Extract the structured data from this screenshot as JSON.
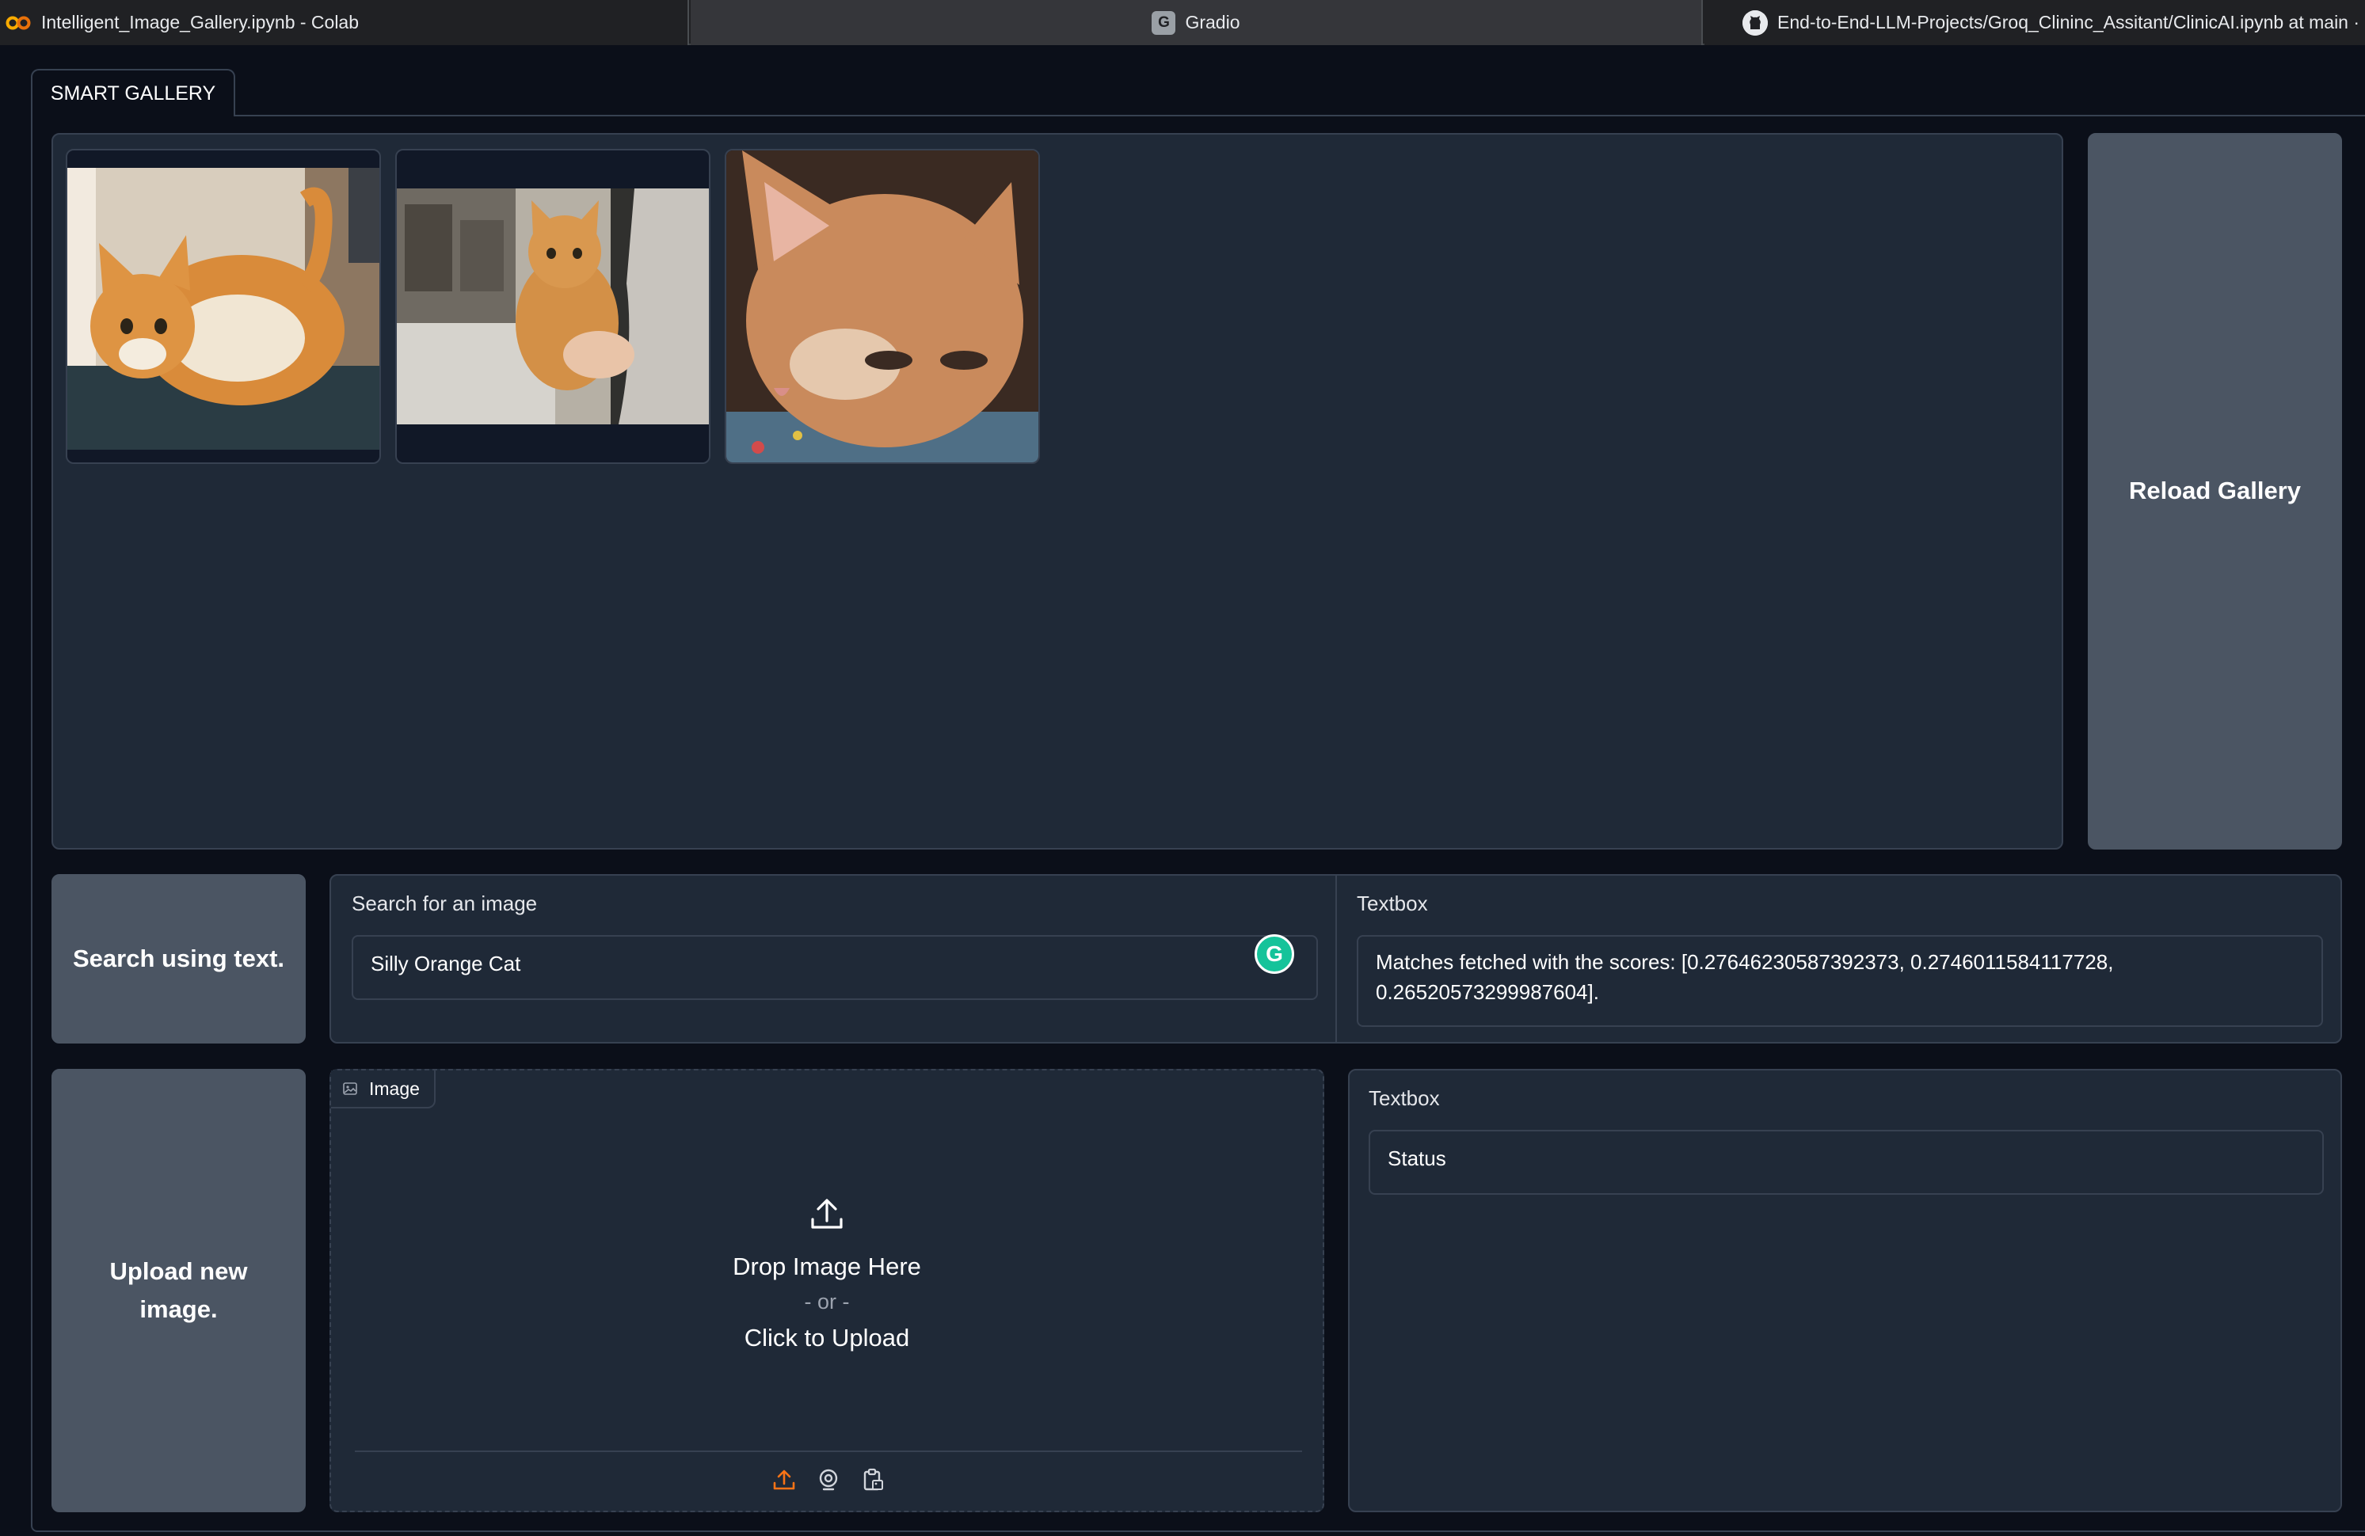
{
  "browser": {
    "tabs": [
      {
        "title": "Intelligent_Image_Gallery.ipynb - Colab",
        "icon": "colab-logo-icon",
        "active": false
      },
      {
        "title": "Gradio",
        "icon": "gradio-favicon-icon",
        "favicon_letter": "G",
        "active": true
      },
      {
        "title": "End-to-End-LLM-Projects/Groq_Clininc_Assitant/ClinicAI.ipynb at main ·",
        "icon": "github-icon",
        "active": false
      }
    ]
  },
  "app": {
    "tab_label": "SMART GALLERY",
    "gallery": {
      "images": [
        {
          "alt": "orange cat crouching",
          "icon": "cat-photo"
        },
        {
          "alt": "orange cat held in arms",
          "icon": "cat-photo"
        },
        {
          "alt": "orange cat face close-up",
          "icon": "cat-photo"
        }
      ]
    },
    "reload_button": "Reload Gallery",
    "search_button": "Search using text.",
    "search": {
      "label": "Search for an image",
      "value": "Silly Orange Cat",
      "grammarly_letter": "G"
    },
    "result": {
      "label": "Textbox",
      "value": "Matches fetched with the scores: [0.27646230587392373, 0.2746011584117728, 0.26520573299987604]."
    },
    "upload_button": "Upload new image.",
    "image_input": {
      "badge": "Image",
      "drop_text": "Drop Image Here",
      "or_text": "- or -",
      "click_text": "Click to Upload",
      "sources": [
        "upload-icon",
        "webcam-icon",
        "clipboard-icon"
      ]
    },
    "status": {
      "label": "Textbox",
      "value": "Status"
    }
  },
  "colors": {
    "background": "#0b0f19",
    "panel": "#1f2937",
    "border": "#374151",
    "button": "#4b5563",
    "accent_orange": "#f97316",
    "grammarly_green": "#15c39a"
  }
}
